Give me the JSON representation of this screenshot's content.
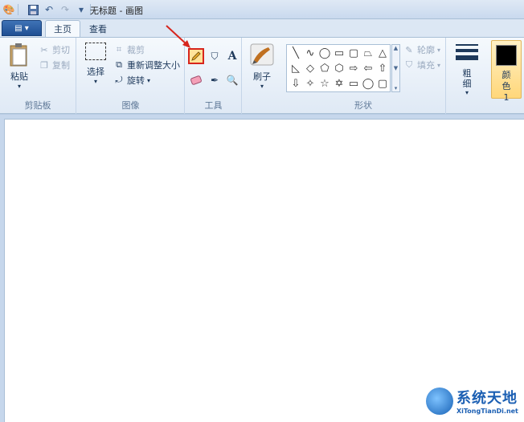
{
  "window": {
    "title": "无标题 - 画图"
  },
  "qat": {
    "icons": [
      "paint-app-icon",
      "save-icon",
      "undo-icon",
      "redo-icon",
      "dropdown-icon"
    ]
  },
  "tabs": {
    "file": "▤ ▾",
    "home": "主页",
    "view": "查看"
  },
  "clipboard": {
    "paste": "粘贴",
    "cut": "剪切",
    "copy": "复制",
    "label": "剪贴板"
  },
  "image": {
    "select": "选择",
    "crop": "裁剪",
    "resize": "重新调整大小",
    "rotate": "旋转",
    "label": "图像"
  },
  "tools": {
    "label": "工具",
    "text_glyph": "A"
  },
  "brushes": {
    "label": "刷子"
  },
  "shapes": {
    "label": "形状",
    "outline": "轮廓",
    "fill": "填充",
    "glyphs": [
      "╲",
      "∿",
      "◯",
      "▭",
      "▢",
      "⏢",
      "△",
      "◺",
      "◇",
      "⬠",
      "⬡",
      "⇨",
      "⇦",
      "⇧",
      "⇩",
      "✧",
      "☆",
      "✡",
      "▭",
      "◯",
      "▢"
    ]
  },
  "size": {
    "label": "粗细"
  },
  "color1": {
    "label": "颜色 1",
    "value": "#000000"
  },
  "watermark": {
    "cn": "系统天地",
    "en": "XiTongTianDi.net"
  },
  "colors": {
    "highlight": "#d7251d",
    "pencil_bg": "#ffe39a"
  }
}
